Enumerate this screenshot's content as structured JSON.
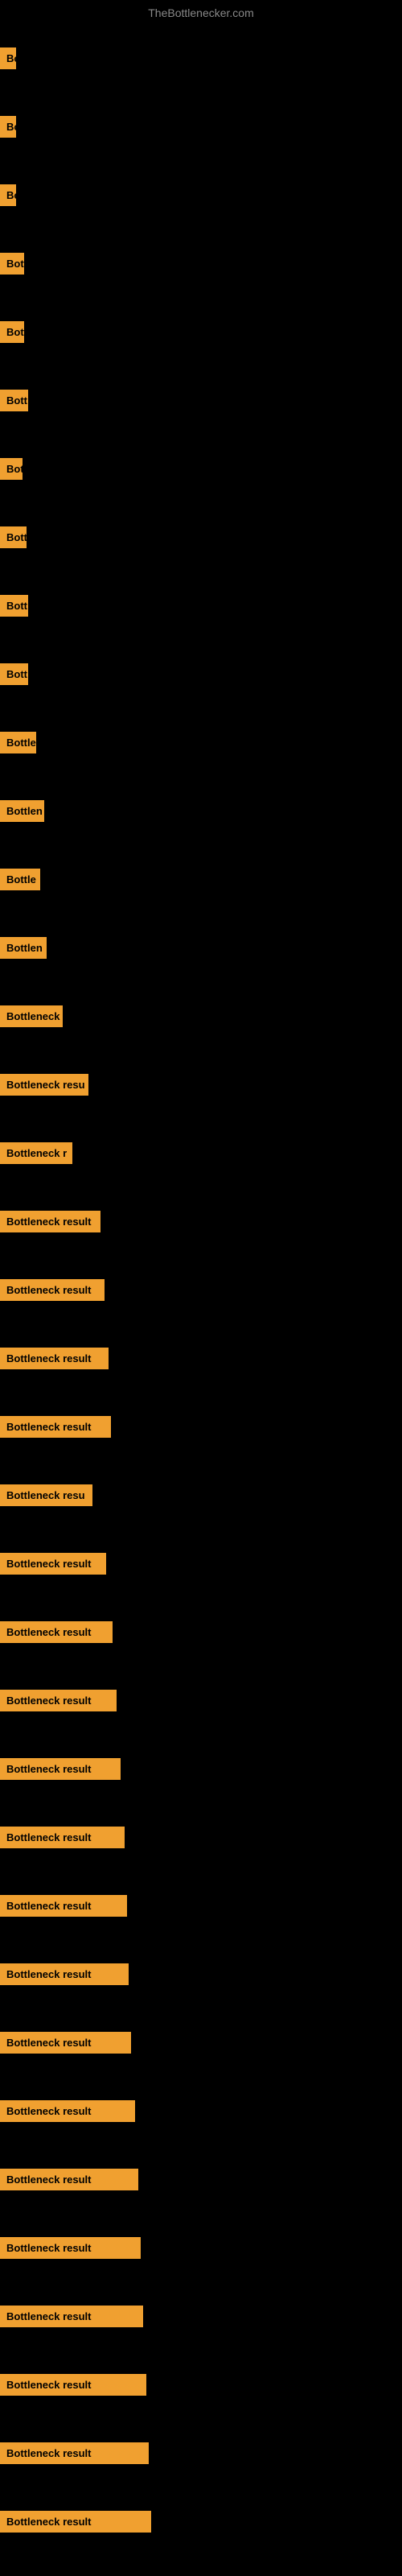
{
  "site": {
    "title": "TheBottlenecker.com"
  },
  "items": [
    {
      "id": 1,
      "label": "Bo",
      "width": 20
    },
    {
      "id": 2,
      "label": "Bo",
      "width": 20
    },
    {
      "id": 3,
      "label": "Bo",
      "width": 20
    },
    {
      "id": 4,
      "label": "Bott",
      "width": 30
    },
    {
      "id": 5,
      "label": "Bott",
      "width": 30
    },
    {
      "id": 6,
      "label": "Bott",
      "width": 35
    },
    {
      "id": 7,
      "label": "Bot",
      "width": 28
    },
    {
      "id": 8,
      "label": "Bott",
      "width": 33
    },
    {
      "id": 9,
      "label": "Bott",
      "width": 35
    },
    {
      "id": 10,
      "label": "Bott",
      "width": 35
    },
    {
      "id": 11,
      "label": "Bottle",
      "width": 45
    },
    {
      "id": 12,
      "label": "Bottlen",
      "width": 55
    },
    {
      "id": 13,
      "label": "Bottle",
      "width": 50
    },
    {
      "id": 14,
      "label": "Bottlen",
      "width": 58
    },
    {
      "id": 15,
      "label": "Bottleneck",
      "width": 78
    },
    {
      "id": 16,
      "label": "Bottleneck resu",
      "width": 110
    },
    {
      "id": 17,
      "label": "Bottleneck r",
      "width": 90
    },
    {
      "id": 18,
      "label": "Bottleneck result",
      "width": 125
    },
    {
      "id": 19,
      "label": "Bottleneck result",
      "width": 130
    },
    {
      "id": 20,
      "label": "Bottleneck result",
      "width": 135
    },
    {
      "id": 21,
      "label": "Bottleneck result",
      "width": 138
    },
    {
      "id": 22,
      "label": "Bottleneck resu",
      "width": 115
    },
    {
      "id": 23,
      "label": "Bottleneck result",
      "width": 132
    },
    {
      "id": 24,
      "label": "Bottleneck result",
      "width": 140
    },
    {
      "id": 25,
      "label": "Bottleneck result",
      "width": 145
    },
    {
      "id": 26,
      "label": "Bottleneck result",
      "width": 150
    },
    {
      "id": 27,
      "label": "Bottleneck result",
      "width": 155
    },
    {
      "id": 28,
      "label": "Bottleneck result",
      "width": 158
    },
    {
      "id": 29,
      "label": "Bottleneck result",
      "width": 160
    },
    {
      "id": 30,
      "label": "Bottleneck result",
      "width": 163
    },
    {
      "id": 31,
      "label": "Bottleneck result",
      "width": 168
    },
    {
      "id": 32,
      "label": "Bottleneck result",
      "width": 172
    },
    {
      "id": 33,
      "label": "Bottleneck result",
      "width": 175
    },
    {
      "id": 34,
      "label": "Bottleneck result",
      "width": 178
    },
    {
      "id": 35,
      "label": "Bottleneck result",
      "width": 182
    },
    {
      "id": 36,
      "label": "Bottleneck result",
      "width": 185
    },
    {
      "id": 37,
      "label": "Bottleneck result",
      "width": 188
    }
  ]
}
